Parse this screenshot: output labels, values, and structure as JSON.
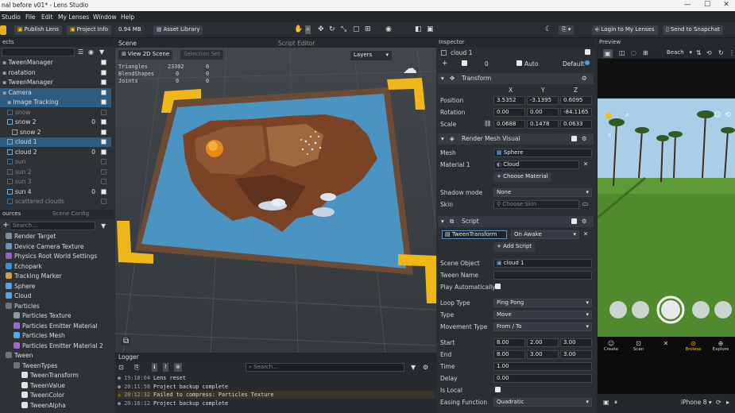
{
  "window": {
    "title": "nal before v01* - Lens Studio",
    "minimize": "—",
    "maximize": "☐",
    "close": "✕"
  },
  "menu": [
    "Studio",
    "File",
    "Edit",
    "My Lenses",
    "Window",
    "Help"
  ],
  "toolbar": {
    "publish": "Publish Lens",
    "project_info": "Project Info",
    "size": "0.94 MB",
    "asset_library": "Asset Library",
    "login": "Login to My Lenses",
    "send": "Send to Snapchat"
  },
  "panels": {
    "scene": "Scene",
    "script_editor": "Script Editor",
    "inspector": "Inspector",
    "preview": "Preview",
    "logger": "Logger",
    "resources": "ources",
    "scene_config": "Scene Config"
  },
  "hierarchy": [
    {
      "label": "TweenManager",
      "indent": 0,
      "type": "obj",
      "on": true
    },
    {
      "label": "roatation",
      "indent": 0,
      "type": "obj",
      "on": true
    },
    {
      "label": "TweenManager",
      "indent": 0,
      "type": "obj",
      "on": true
    },
    {
      "label": "Camera",
      "indent": 0,
      "type": "obj",
      "on": true,
      "sel": true
    },
    {
      "label": "Image Tracking",
      "indent": 1,
      "type": "obj",
      "on": true,
      "sel": true
    },
    {
      "label": "snow",
      "indent": 1,
      "type": "cube",
      "on": false,
      "dim": true
    },
    {
      "label": "snow 2",
      "indent": 1,
      "type": "cube",
      "on": true,
      "count": "0"
    },
    {
      "label": "snow 2",
      "indent": 2,
      "type": "cube",
      "on": true
    },
    {
      "label": "cloud 1",
      "indent": 1,
      "type": "cube",
      "on": true,
      "sel": true
    },
    {
      "label": "cloud 2",
      "indent": 1,
      "type": "cube",
      "on": true,
      "count": "0"
    },
    {
      "label": "sun",
      "indent": 1,
      "type": "cube",
      "on": false,
      "dim": true
    },
    {
      "label": "sun 2",
      "indent": 1,
      "type": "cube",
      "on": false,
      "dim": true
    },
    {
      "label": "sun 3",
      "indent": 1,
      "type": "cube",
      "on": false,
      "dim": true
    },
    {
      "label": "sun 4",
      "indent": 1,
      "type": "cube",
      "on": true,
      "count": "0"
    },
    {
      "label": "scattered clouds",
      "indent": 1,
      "type": "cube",
      "on": false,
      "dim": true
    }
  ],
  "resources_search": "Search...",
  "resources": [
    {
      "label": "Render Target",
      "icon": "#7c8ea0"
    },
    {
      "label": "Device Camera Texture",
      "icon": "#6c8fb5"
    },
    {
      "label": "Physics Root World Settings",
      "icon": "#8b6bb8"
    },
    {
      "label": "Echopark",
      "icon": "#3f8fd0"
    },
    {
      "label": "Tracking Marker",
      "icon": "#d2a04a"
    },
    {
      "label": "Sphere",
      "icon": "#5aa5e0"
    },
    {
      "label": "Cloud",
      "icon": "#5aa5e0"
    },
    {
      "label": "Particles",
      "icon": "#6a7580"
    },
    {
      "label": "Particles Texture",
      "icon": "#8d9aa8",
      "indent": 1
    },
    {
      "label": "Particles Emitter Material",
      "icon": "#9a6ccf",
      "indent": 1
    },
    {
      "label": "Particles Mesh",
      "icon": "#5aa5e0",
      "indent": 1
    },
    {
      "label": "Particles Emitter Material 2",
      "icon": "#9a6ccf",
      "indent": 1
    },
    {
      "label": "Tween",
      "icon": "#6a7580"
    },
    {
      "label": "TweenTypes",
      "icon": "#6a7580",
      "indent": 1
    },
    {
      "label": "TweenTransform",
      "icon": "#dfe3e6",
      "indent": 2
    },
    {
      "label": "TweenValue",
      "icon": "#dfe3e6",
      "indent": 2
    },
    {
      "label": "TweenColor",
      "icon": "#dfe3e6",
      "indent": 2
    },
    {
      "label": "TweenAlpha",
      "icon": "#dfe3e6",
      "indent": 2
    }
  ],
  "scene_view": {
    "mode_button": "View 2D Scene",
    "selection_set": "Selection Set",
    "layers": "Layers",
    "stats": [
      {
        "k": "Triangles",
        "v": "23302",
        "v2": "0"
      },
      {
        "k": "BlendShapes",
        "v": "0",
        "v2": "0"
      },
      {
        "k": "Joints",
        "v": "0",
        "v2": "0"
      }
    ]
  },
  "logger": {
    "search": "Search...",
    "rows": [
      {
        "time": "19:18:04",
        "msg": "Lens reset",
        "type": "info"
      },
      {
        "time": "20:11:58",
        "msg": "Project backup complete",
        "type": "info"
      },
      {
        "time": "20:12:32",
        "msg": "Failed to compress: Particles Texture",
        "type": "warn"
      },
      {
        "time": "20:16:12",
        "msg": "Project backup complete",
        "type": "info"
      }
    ]
  },
  "inspector": {
    "object_name": "cloud 1",
    "layer_count": "0",
    "auto": "Auto",
    "default": "Default",
    "transform": {
      "title": "Transform",
      "x": "X",
      "y": "Y",
      "z": "Z",
      "position_label": "Position",
      "position": [
        "3.5352",
        "-3.1395",
        "0.6095"
      ],
      "rotation_label": "Rotation",
      "rotation": [
        "0.00",
        "0.00",
        "-84.1165"
      ],
      "scale_label": "Scale",
      "scale": [
        "0.0688",
        "0.1478",
        "0.0633"
      ]
    },
    "render": {
      "title": "Render Mesh Visual",
      "mesh_label": "Mesh",
      "mesh": "Sphere",
      "material_label": "Material 1",
      "material": "Cloud",
      "choose": "Choose Material",
      "shadow_label": "Shadow mode",
      "shadow": "None",
      "skin_label": "Skin",
      "skin": "Choose Skin"
    },
    "script": {
      "title": "Script",
      "name": "TweenTransform",
      "event": "On Awake",
      "add": "Add Script",
      "fields": [
        {
          "label": "Scene Object",
          "value": "cloud 1",
          "kind": "obj"
        },
        {
          "label": "Tween Name",
          "value": "",
          "kind": "text"
        },
        {
          "label": "Play Automatically",
          "value": "",
          "kind": "check"
        },
        {
          "label": "Loop Type",
          "value": "Ping Pong",
          "kind": "drop"
        },
        {
          "label": "Type",
          "value": "Move",
          "kind": "drop"
        },
        {
          "label": "Movement Type",
          "value": "From / To",
          "kind": "drop"
        },
        {
          "label": "Start",
          "values": [
            "8.00",
            "2.00",
            "3.00"
          ],
          "kind": "vec"
        },
        {
          "label": "End",
          "values": [
            "8.00",
            "3.00",
            "3.00"
          ],
          "kind": "vec"
        },
        {
          "label": "Time",
          "value": "1.00",
          "kind": "text"
        },
        {
          "label": "Delay",
          "value": "0.00",
          "kind": "text"
        },
        {
          "label": "Is Local",
          "value": "",
          "kind": "check"
        },
        {
          "label": "Easing Function",
          "value": "Quadratic",
          "kind": "drop"
        }
      ]
    }
  },
  "preview": {
    "location": "Beach",
    "device": "iPhone 8",
    "tabs": [
      "Create",
      "Scan",
      "",
      "Browse",
      "Explore"
    ]
  },
  "colors": {
    "accent": "#f2c21a",
    "select": "#2e5c80",
    "map_water": "#4a94c4",
    "map_land": "#7a4326",
    "frame": "#6b4a36",
    "grass": "#4f8a2c",
    "sky": "#a9cfe8"
  }
}
